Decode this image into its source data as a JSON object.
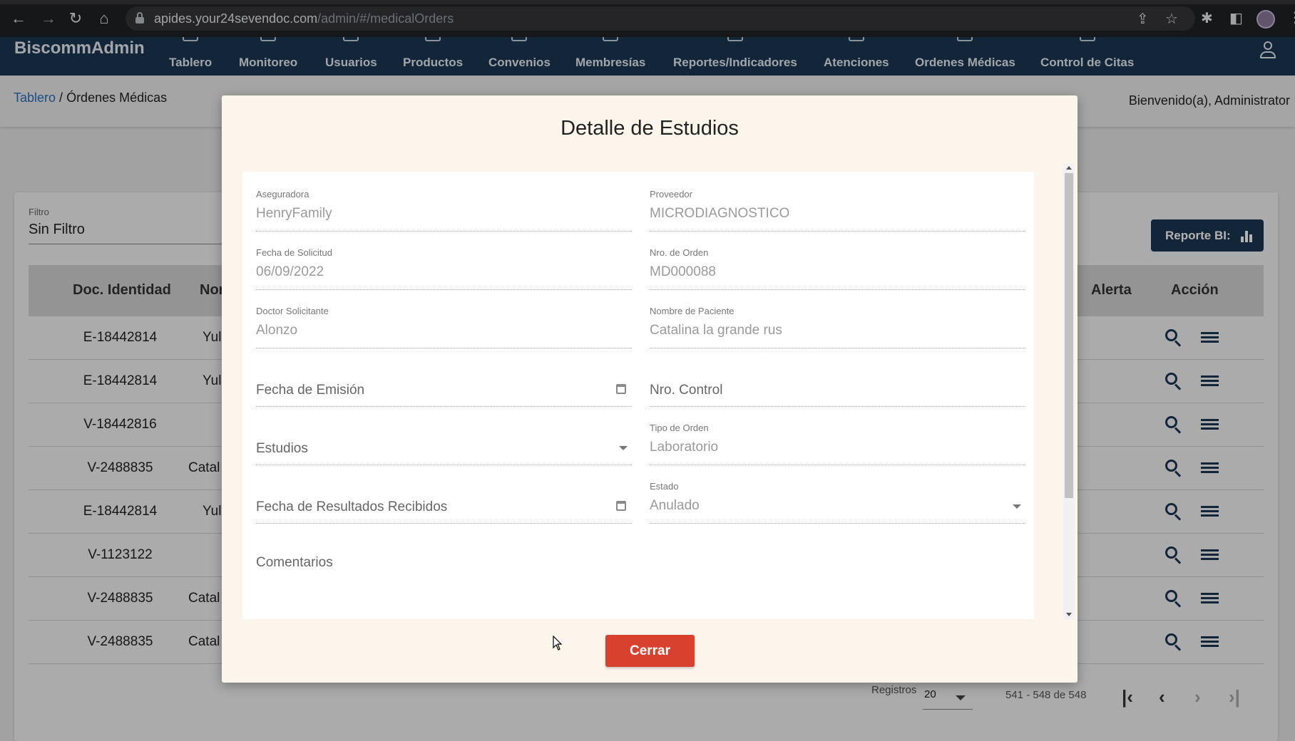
{
  "browser": {
    "url_host": "apides.your24sevendoc.com",
    "url_path": "/admin/#/medicalOrders"
  },
  "app": {
    "brand": "BiscommAdmin",
    "nav": [
      "Tablero",
      "Monitoreo",
      "Usuarios",
      "Productos",
      "Convenios",
      "Membresías",
      "Reportes/Indicadores",
      "Atenciones",
      "Ordenes Médicas",
      "Control de Citas"
    ]
  },
  "breadcrumb": {
    "link": "Tablero",
    "separator": " / ",
    "current": "Órdenes Médicas"
  },
  "welcome": "Bienvenido(a), Administrator",
  "filter": {
    "label": "Filtro",
    "value": "Sin Filtro"
  },
  "report_button": "Reporte BI:",
  "table": {
    "headers": {
      "doc": "Doc. Identidad",
      "name": "Nor",
      "alert": "Alerta",
      "action": "Acción"
    },
    "rows": [
      {
        "doc": "E-18442814",
        "name": "Yul"
      },
      {
        "doc": "E-18442814",
        "name": "Yul"
      },
      {
        "doc": "V-18442816",
        "name": ""
      },
      {
        "doc": "V-2488835",
        "name": "Catal"
      },
      {
        "doc": "E-18442814",
        "name": "Yul"
      },
      {
        "doc": "V-1123122",
        "name": ""
      },
      {
        "doc": "V-2488835",
        "name": "Catal"
      },
      {
        "doc": "V-2488835",
        "name": "Catal"
      }
    ]
  },
  "pager": {
    "label": "Registros",
    "page_size": "20",
    "range": "541 - 548 de 548"
  },
  "modal": {
    "title": "Detalle de Estudios",
    "fields": {
      "aseguradora": {
        "label": "Aseguradora",
        "value": "HenryFamily"
      },
      "proveedor": {
        "label": "Proveedor",
        "value": "MICRODIAGNOSTICO"
      },
      "fecha_solicitud": {
        "label": "Fecha de Solicitud",
        "value": "06/09/2022"
      },
      "nro_orden": {
        "label": "Nro. de Orden",
        "value": "MD000088"
      },
      "doctor": {
        "label": "Doctor Solicitante",
        "value": "Alonzo"
      },
      "paciente": {
        "label": "Nombre de Paciente",
        "value": "Catalina la grande rus"
      },
      "fecha_emision": {
        "placeholder": "Fecha de Emisión"
      },
      "nro_control": {
        "placeholder": "Nro. Control"
      },
      "estudios": {
        "placeholder": "Estudios"
      },
      "tipo_orden": {
        "label": "Tipo de Orden",
        "value": "Laboratorio"
      },
      "fecha_resultados": {
        "placeholder": "Fecha de Resultados Recibidos"
      },
      "estado": {
        "label": "Estado",
        "value": "Anulado"
      },
      "comentarios": {
        "placeholder": "Comentarios"
      }
    },
    "close_button": "Cerrar"
  },
  "colors": {
    "header": "#1b3552",
    "modal_bg": "#fcf5ec",
    "close_button": "#d9412f",
    "link": "#2c6fbf"
  }
}
